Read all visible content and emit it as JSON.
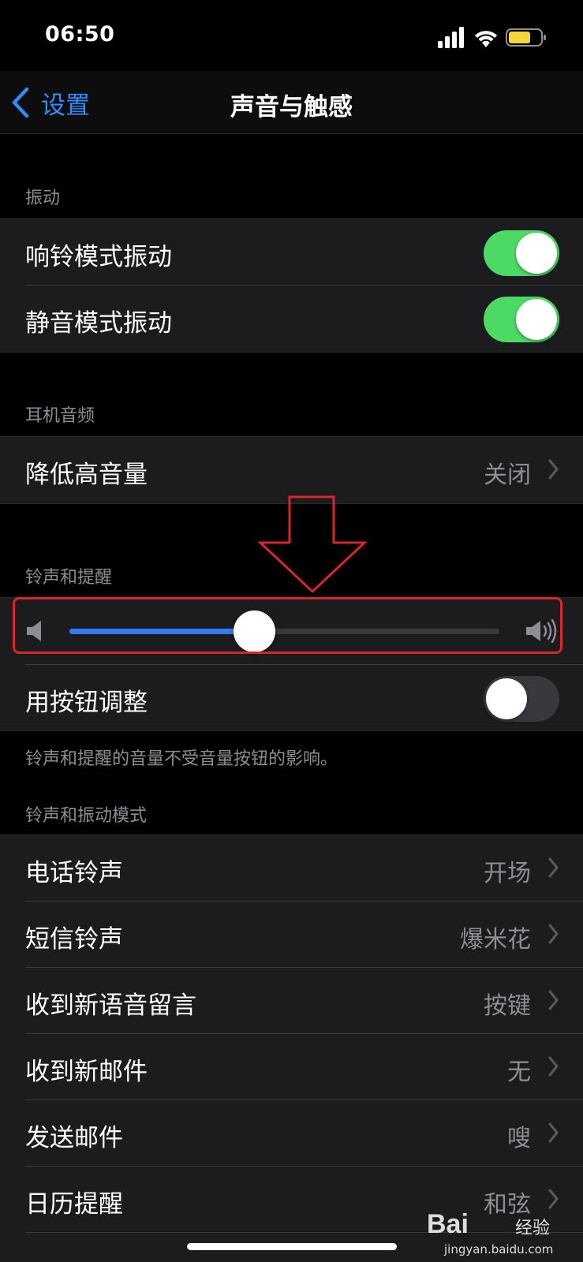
{
  "status_bar": {
    "time": "06:50",
    "battery_color": "#f5d73a"
  },
  "nav": {
    "back_label": "设置",
    "title": "声音与触感",
    "accent_color": "#2f8cff"
  },
  "sections": {
    "vibration": {
      "header": "振动",
      "rows": [
        {
          "label": "响铃模式振动",
          "toggle": "on"
        },
        {
          "label": "静音模式振动",
          "toggle": "on"
        }
      ]
    },
    "headphone_audio": {
      "header": "耳机音频",
      "rows": [
        {
          "label": "降低高音量",
          "value": "关闭"
        }
      ]
    },
    "ringer_alerts": {
      "header": "铃声和提醒",
      "volume_level": 0.43,
      "change_with_buttons": {
        "label": "用按钮调整",
        "toggle": "off"
      },
      "footer": "铃声和提醒的音量不受音量按钮的影响。"
    },
    "sounds_patterns": {
      "header": "铃声和振动模式",
      "rows": [
        {
          "label": "电话铃声",
          "value": "开场"
        },
        {
          "label": "短信铃声",
          "value": "爆米花"
        },
        {
          "label": "收到新语音留言",
          "value": "按键"
        },
        {
          "label": "收到新邮件",
          "value": "无"
        },
        {
          "label": "发送邮件",
          "value": "嗖"
        },
        {
          "label": "日历提醒",
          "value": "和弦"
        }
      ]
    }
  },
  "annotation_color": "#d9252c",
  "watermark": {
    "brand": "Bai",
    "text": "经验",
    "url": "jingyan.baidu.com"
  }
}
